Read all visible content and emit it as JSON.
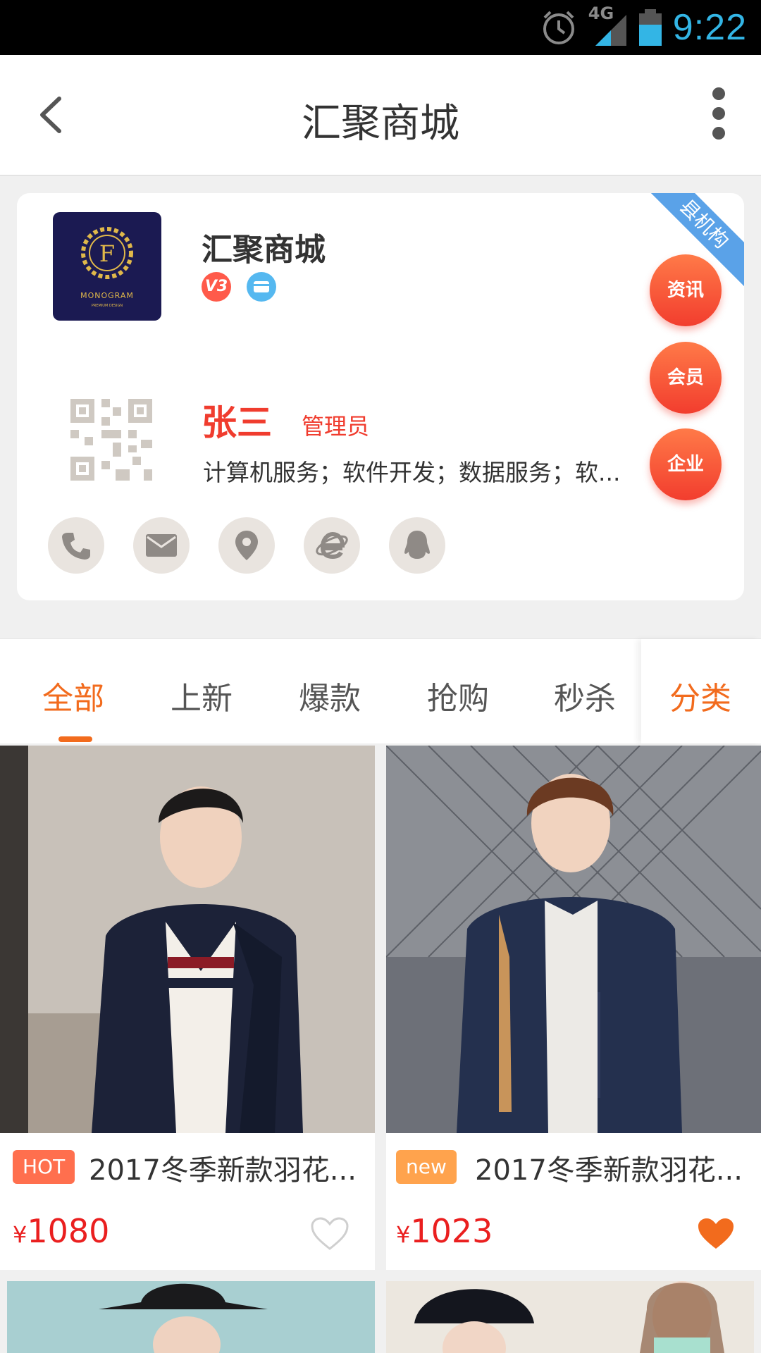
{
  "status_bar": {
    "time": "9:22",
    "network": "4G"
  },
  "header": {
    "title": "汇聚商城"
  },
  "shop": {
    "name": "汇聚商城",
    "logo_text": "MONOGRAM",
    "logo_sub": "PREMIUM DESIGN",
    "logo_letter": "F",
    "level_badge": "V3",
    "ribbon": "县机构",
    "side_buttons": [
      "资讯",
      "会员",
      "企业"
    ],
    "person_name": "张三",
    "person_role": "管理员",
    "business": "计算机服务；软件开发；数据服务；软...",
    "contact_icons": [
      "phone-icon",
      "mail-icon",
      "location-icon",
      "browser-icon",
      "qq-icon"
    ]
  },
  "tabs": {
    "items": [
      "全部",
      "上新",
      "爆款",
      "抢购",
      "秒杀"
    ],
    "active_index": 0,
    "category": "分类"
  },
  "products": [
    {
      "tag": "HOT",
      "tag_color": "#ff6f4e",
      "name": "2017冬季新款羽花...",
      "currency": "¥",
      "price": "1080",
      "favorited": false
    },
    {
      "tag": "new",
      "tag_color": "#ffa34d",
      "name": "2017冬季新款羽花...",
      "currency": "¥",
      "price": "1023",
      "favorited": true
    }
  ],
  "colors": {
    "accent": "#f26b1d",
    "price": "#ea1f1f",
    "status": "#33b5e5"
  }
}
